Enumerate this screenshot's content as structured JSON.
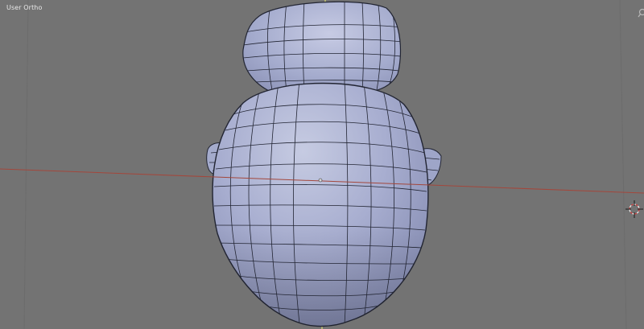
{
  "viewport": {
    "label": "User Ortho",
    "background": "#737373",
    "x_axis_color": "#a3473c",
    "y_axis_color": "#cfd06a",
    "mesh_face_color": "#a9b0cf",
    "mesh_edge_color": "#222533",
    "mesh_object": "head-mesh",
    "nav_icon": "zoom-icon",
    "cursor_icon": "view-cursor-icon"
  }
}
